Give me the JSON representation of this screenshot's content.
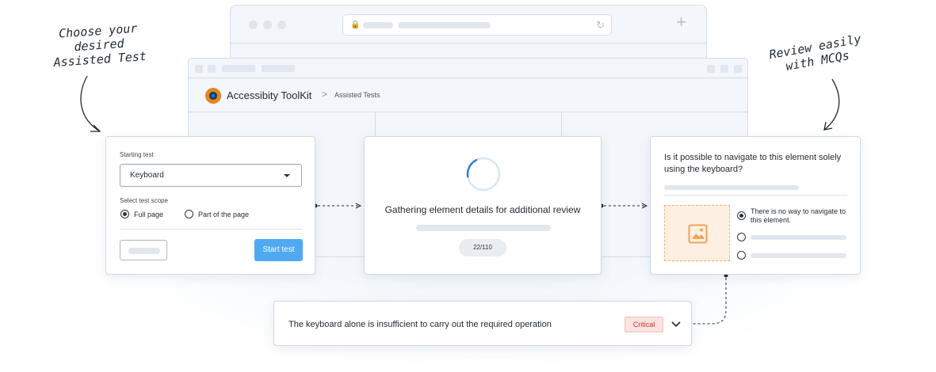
{
  "annotations": {
    "left": [
      "Choose your",
      "desired",
      "Assisted Test"
    ],
    "right": [
      "Review easily",
      "with MCQs"
    ]
  },
  "app": {
    "title": "Accessibity ToolKit",
    "breadcrumb_separator": ">",
    "breadcrumb": "Assisted Tests"
  },
  "start_card": {
    "starting_test_label": "Starting test",
    "selected_test": "Keyboard",
    "scope_label": "Select test scope",
    "scope_options": [
      {
        "label": "Full page",
        "selected": true
      },
      {
        "label": "Part of the page",
        "selected": false
      }
    ],
    "start_button": "Start test"
  },
  "progress_card": {
    "message": "Gathering element details for additional review",
    "counter": "22/110",
    "progress_fraction": 0.2
  },
  "mcq_card": {
    "question": "Is it possible to navigate to this element solely using the keyboard?",
    "options": [
      {
        "label": "There is no way to navigate to this element.",
        "selected": true
      },
      {
        "label": "",
        "selected": false
      },
      {
        "label": "",
        "selected": false
      }
    ]
  },
  "result_card": {
    "text": "The keyboard alone is insufficient to carry out the required operation",
    "severity": "Critical"
  },
  "colors": {
    "primary": "#4fa9f2",
    "critical_bg": "#fbe3e1",
    "critical_text": "#b93a2d",
    "image_placeholder": "#f2b07a"
  }
}
